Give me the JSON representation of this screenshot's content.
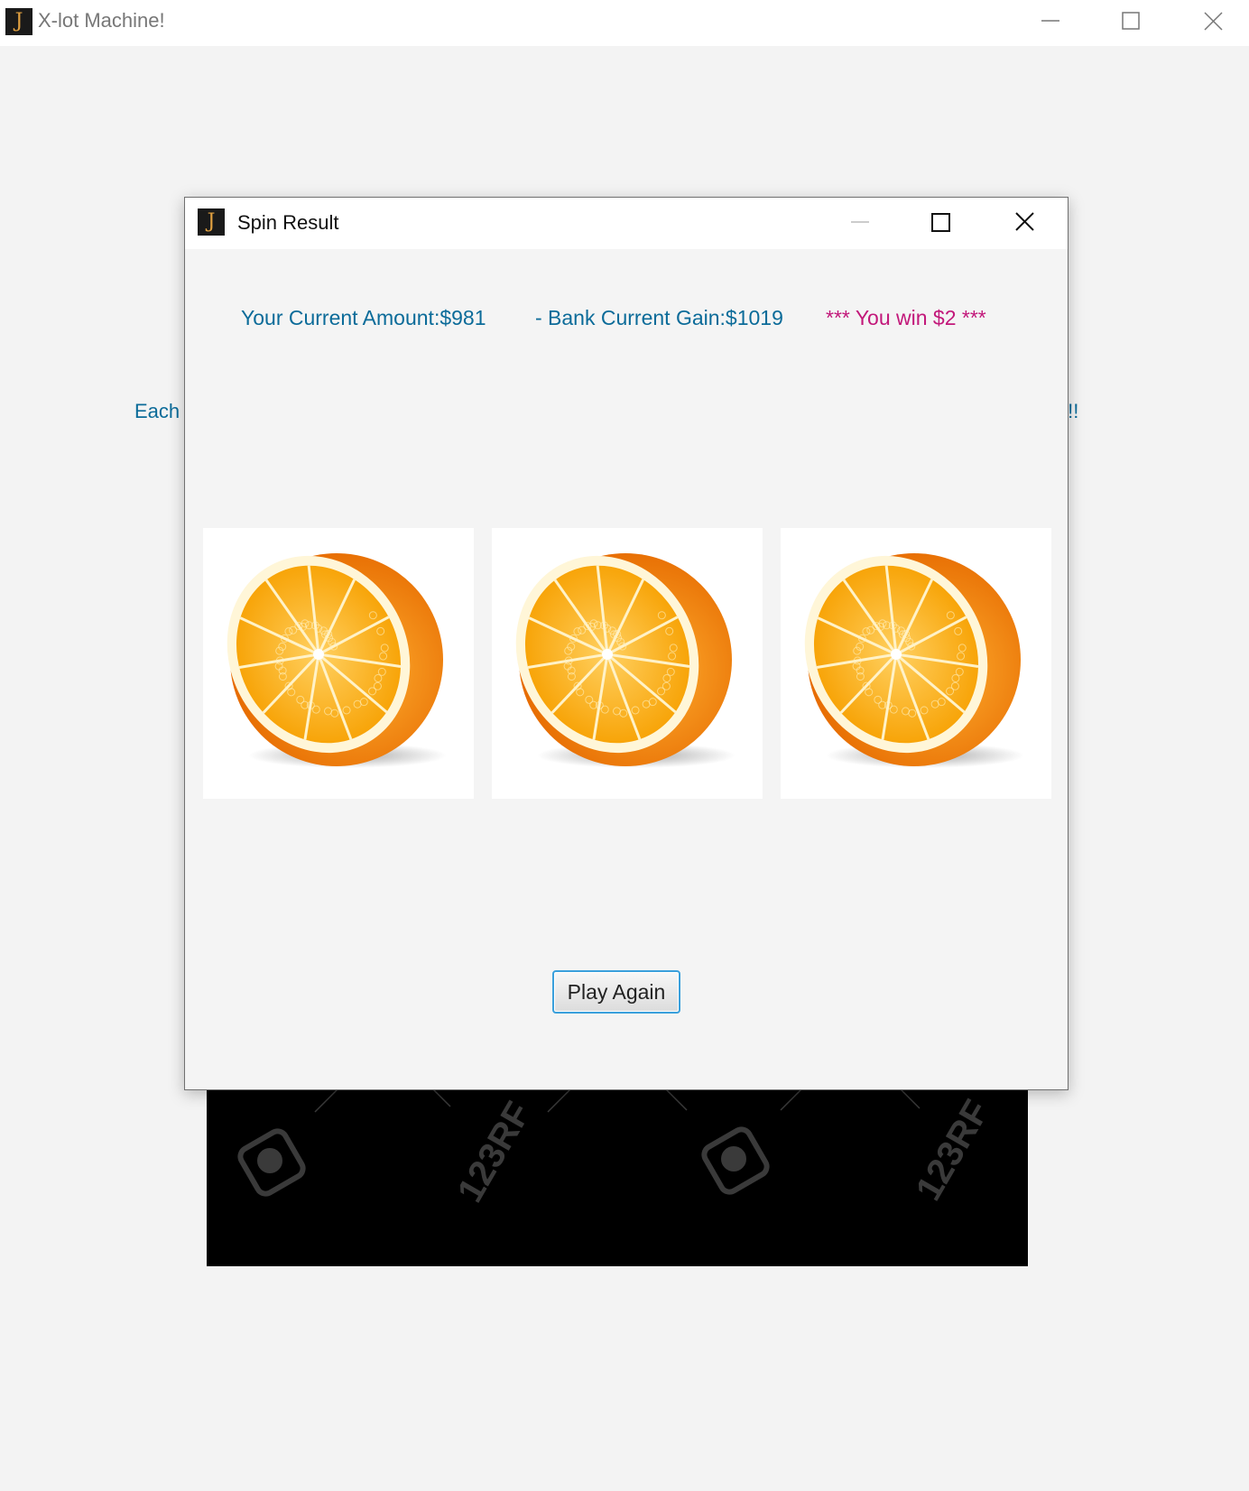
{
  "main_window": {
    "title": "X-lot Machine!",
    "icon_letter": "J",
    "background_text_left": "Each",
    "background_text_right": "k !!",
    "background_image_watermark": "123RF"
  },
  "dialog": {
    "title": "Spin Result",
    "icon_letter": "J",
    "current_amount": "Your Current Amount:$981",
    "bank_gain": "- Bank Current Gain:$1019",
    "win_message": "*** You win $2 ***",
    "reels": [
      {
        "symbol": "orange-half"
      },
      {
        "symbol": "orange-half"
      },
      {
        "symbol": "orange-half"
      }
    ],
    "play_again_label": "Play Again"
  },
  "colors": {
    "info_text": "#0b6b99",
    "win_text": "#c2187a",
    "button_border": "#3aa0dc"
  }
}
